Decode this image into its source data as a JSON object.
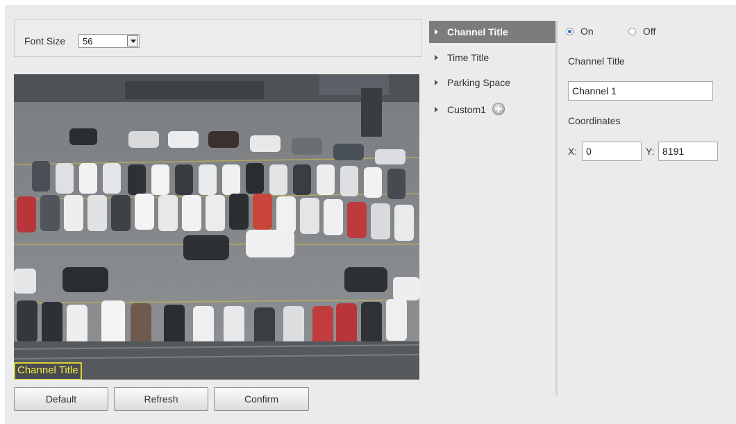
{
  "font": {
    "label": "Font Size",
    "value": "56"
  },
  "video": {
    "osd_channel_text": "Channel Title"
  },
  "buttons": {
    "default": "Default",
    "refresh": "Refresh",
    "confirm": "Confirm"
  },
  "nav": {
    "items": [
      {
        "label": "Channel Title",
        "active": true
      },
      {
        "label": "Time Title",
        "active": false
      },
      {
        "label": "Parking Space",
        "active": false
      },
      {
        "label": "Custom1",
        "active": false
      }
    ]
  },
  "overlay": {
    "on_label": "On",
    "off_label": "Off",
    "selected": "On",
    "channel_title_label": "Channel Title",
    "channel_title_value": "Channel 1",
    "coordinates_label": "Coordinates",
    "x_label": "X:",
    "x_value": "0",
    "y_label": "Y:",
    "y_value": "8191"
  },
  "colors": {
    "nav_active": "#7c7c7c",
    "osd_box": "#d6d13b",
    "radio_on": "#2a6fd6"
  }
}
